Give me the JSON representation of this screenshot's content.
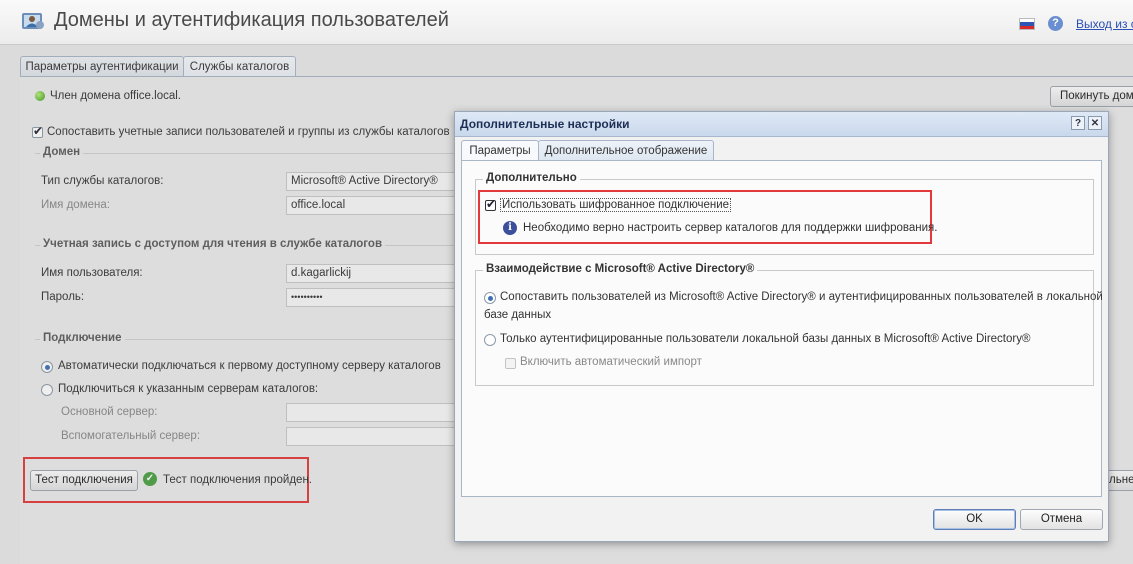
{
  "header": {
    "title": "Домены и аутентификация пользователей",
    "logout": "Выход из си"
  },
  "tabs": [
    {
      "label": "Параметры аутентификации",
      "active": false
    },
    {
      "label": "Службы каталогов",
      "active": true
    }
  ],
  "main": {
    "status_text": "Член домена office.local.",
    "leave_domain_button": "Покинуть доме",
    "map_accounts_checkbox": {
      "label": "Сопоставить учетные записи пользователей и группы из службы каталогов",
      "checked": true
    },
    "domain_section": {
      "title": "Домен",
      "service_type_label": "Тип службы каталогов:",
      "service_type_value": "Microsoft® Active Directory®",
      "domain_name_label": "Имя домена:",
      "domain_name_value": "office.local"
    },
    "account_section": {
      "title": "Учетная запись с доступом для чтения в службе каталогов",
      "username_label": "Имя пользователя:",
      "username_value": "d.kagarlickij",
      "password_label": "Пароль:",
      "password_value": "••••••••••"
    },
    "connection_section": {
      "title": "Подключение",
      "auto_radio": {
        "label": "Автоматически подключаться к первому доступному серверу каталогов",
        "selected": true
      },
      "specified_radio": {
        "label": "Подключиться к указанным серверам каталогов:",
        "selected": false
      },
      "primary_server_label": "Основной сервер:",
      "secondary_server_label": "Вспомогательный сервер:"
    },
    "test_button": "Тест подключения",
    "test_result": "Тест подключения пройден.",
    "right_partial_button": "ельне"
  },
  "dialog": {
    "title": "Дополнительные настройки",
    "help": "?",
    "close": "✕",
    "tabs": [
      {
        "label": "Параметры",
        "active": true
      },
      {
        "label": "Дополнительное отображение",
        "active": false
      }
    ],
    "additional_group": {
      "title": "Дополнительно",
      "encrypted_checkbox": {
        "label": "Использовать шифрованное подключение",
        "checked": true
      },
      "info_text": "Необходимо верно настроить сервер каталогов для поддержки шифрования."
    },
    "interaction_group": {
      "title": "Взаимодействие с Microsoft® Active Directory®",
      "radio_map": {
        "label_line1": "Сопоставить пользователей из Microsoft® Active Directory® и аутентифицированных пользователей в локальной",
        "label_line2": "базе данных",
        "selected": true
      },
      "radio_local_only": {
        "label": "Только аутентифицированные пользователи локальной базы данных в Microsoft® Active Directory®",
        "selected": false
      },
      "auto_import_checkbox": {
        "label": "Включить автоматический импорт",
        "checked": false,
        "disabled": true
      }
    },
    "ok_button": "OK",
    "cancel_button": "Отмена"
  },
  "colors": {
    "highlight_box": "#e23a3a",
    "link": "#2a4fb5"
  }
}
